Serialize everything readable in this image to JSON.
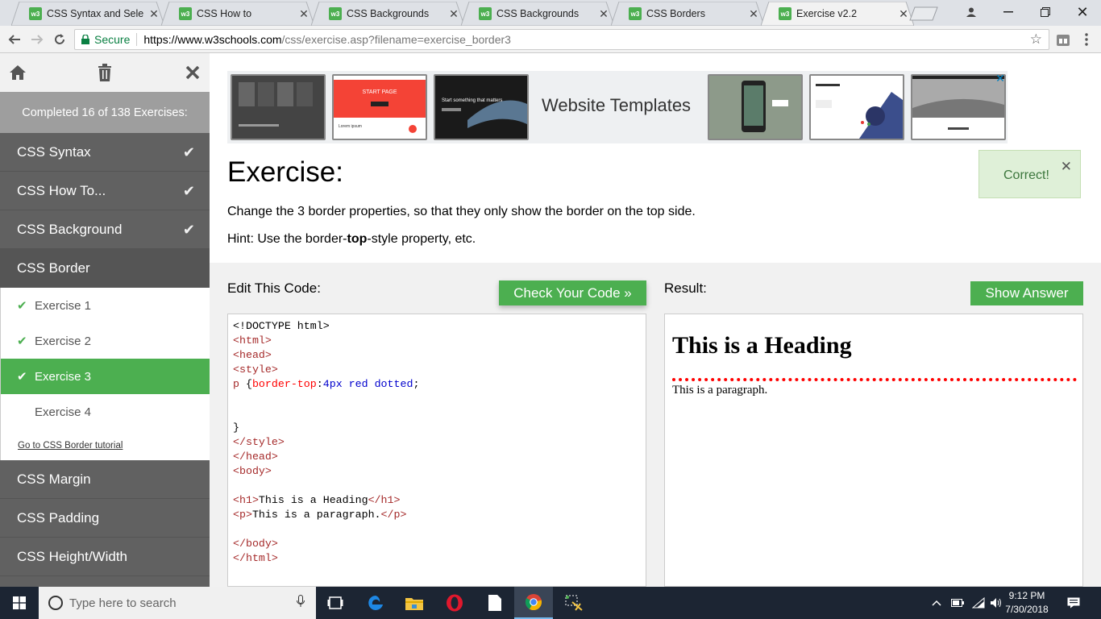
{
  "browser": {
    "tabs": [
      {
        "title": "CSS Syntax and Selectors",
        "active": false
      },
      {
        "title": "CSS How to",
        "active": false
      },
      {
        "title": "CSS Backgrounds",
        "active": false
      },
      {
        "title": "CSS Backgrounds",
        "active": false
      },
      {
        "title": "CSS Borders",
        "active": false
      },
      {
        "title": "Exercise v2.2",
        "active": true
      }
    ],
    "favicon_text": "w3",
    "secure_label": "Secure",
    "url_host": "https://www.w3schools.com",
    "url_path": "/css/exercise.asp?filename=exercise_border3"
  },
  "sidebar": {
    "completed": "Completed 16 of 138 Exercises:",
    "categories_before": [
      {
        "label": "CSS Syntax",
        "done": true
      },
      {
        "label": "CSS How To...",
        "done": true
      },
      {
        "label": "CSS Background",
        "done": true
      },
      {
        "label": "CSS Border",
        "done": false
      }
    ],
    "exercises": [
      {
        "label": "Exercise 1",
        "done": true
      },
      {
        "label": "Exercise 2",
        "done": true
      },
      {
        "label": "Exercise 3",
        "done": true
      },
      {
        "label": "Exercise 4",
        "done": false
      }
    ],
    "tutorial_link": "Go to CSS Border tutorial",
    "categories_after": [
      {
        "label": "CSS Margin"
      },
      {
        "label": "CSS Padding"
      },
      {
        "label": "CSS Height/Width"
      }
    ]
  },
  "ad": {
    "text": "Website Templates",
    "thumb1_text": "START PAGE",
    "thumb2_text": "Start something that matters",
    "thumb3_text": "Lorem ipsum"
  },
  "exercise": {
    "title": "Exercise:",
    "description": "Change the 3 border properties, so that they only show the border on the top side.",
    "hint_pre": "Hint: Use the border-",
    "hint_bold": "top",
    "hint_post": "-style property, etc.",
    "correct": "Correct!"
  },
  "editor": {
    "label": "Edit This Code:",
    "check_button": "Check Your Code »",
    "lines": {
      "doctype": "<!DOCTYPE html>",
      "html_open": "<html>",
      "head_open": "<head>",
      "style_open": "<style>",
      "sel": "p ",
      "brace_open": "{",
      "prop": "border-top",
      "colon": ":",
      "val": "4px red dotted",
      "semi": ";",
      "brace_close": "}",
      "style_close": "</style>",
      "head_close": "</head>",
      "body_open": "<body>",
      "h1_open": "<h1>",
      "h1_text": "This is a Heading",
      "h1_close": "</h1>",
      "p_open": "<p>",
      "p_text": "This is a paragraph.",
      "p_close": "</p>",
      "body_close": "</body>",
      "html_close": "</html>"
    }
  },
  "result": {
    "label": "Result:",
    "answer_button": "Show Answer",
    "heading": "This is a Heading",
    "paragraph": "This is a paragraph."
  },
  "taskbar": {
    "search_placeholder": "Type here to search",
    "time": "9:12 PM",
    "date": "7/30/2018"
  },
  "colors": {
    "w3_green": "#4caf50",
    "sidebar_gray": "#616161",
    "correct_bg": "#dff0d8"
  }
}
